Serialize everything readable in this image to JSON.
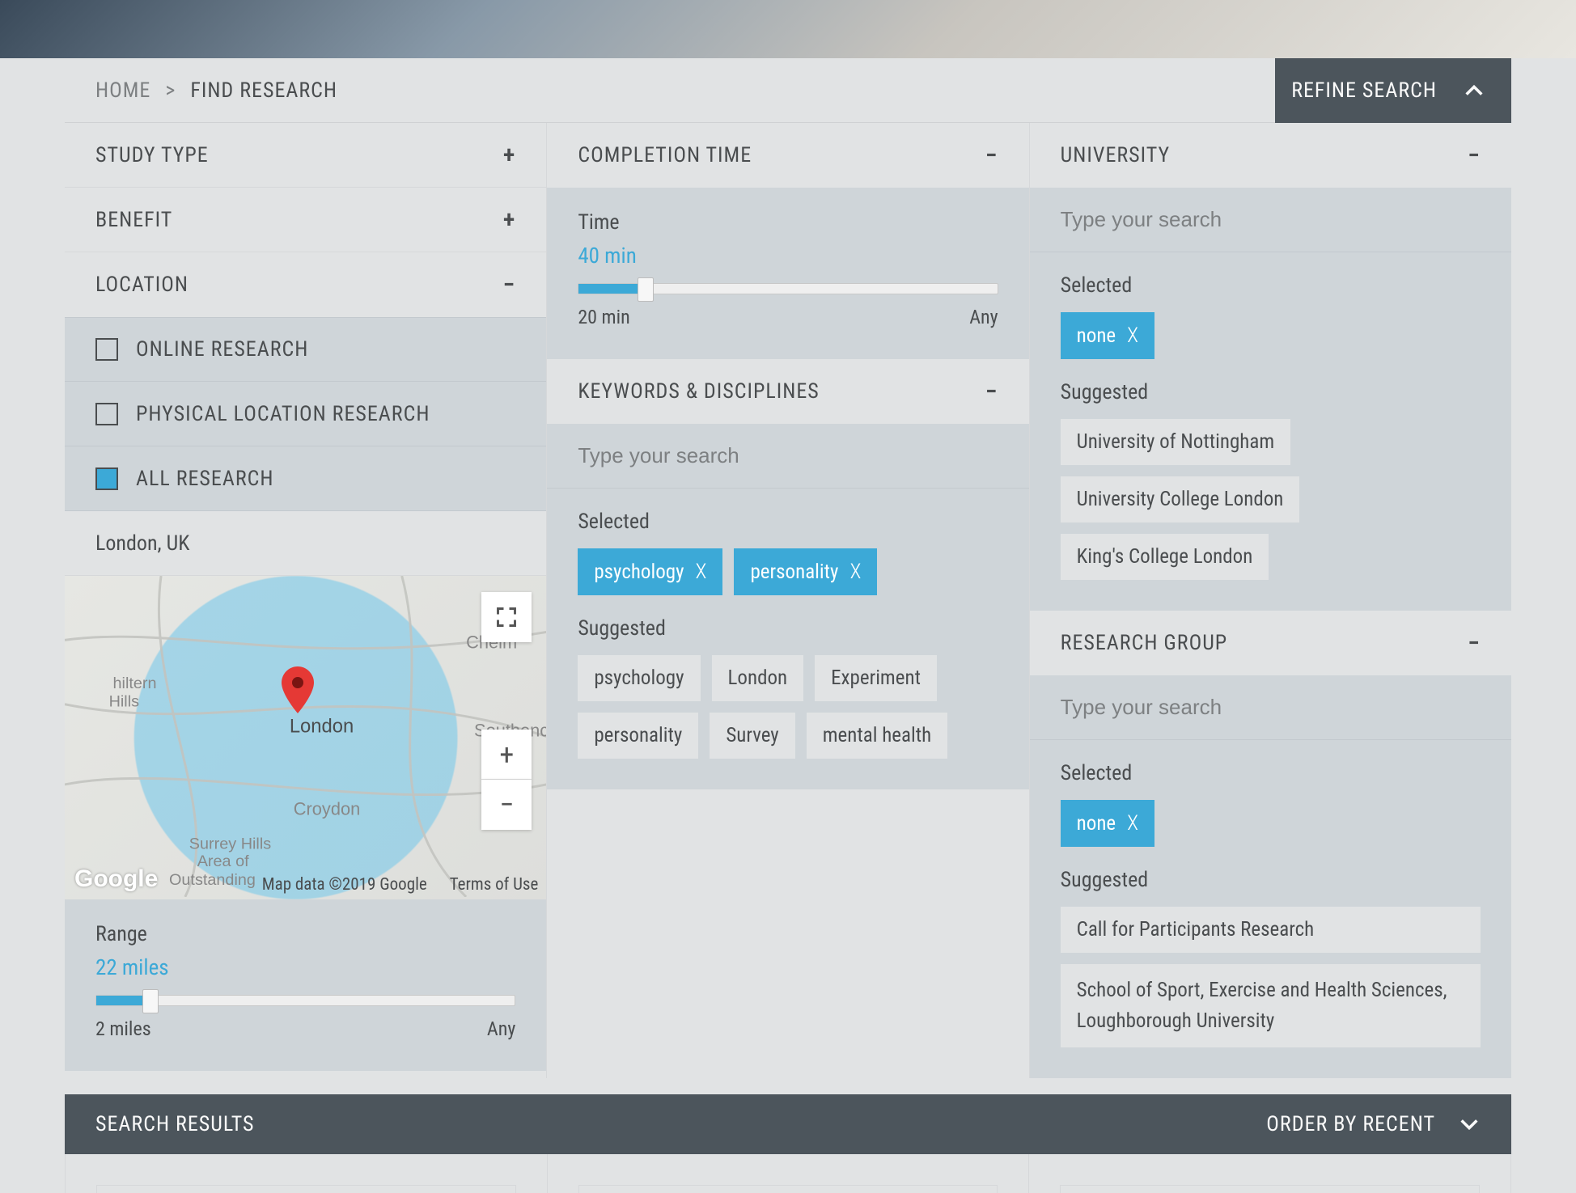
{
  "breadcrumb": {
    "home": "HOME",
    "sep": ">",
    "current": "FIND RESEARCH"
  },
  "refine_search": {
    "label": "REFINE SEARCH"
  },
  "filters": {
    "study_type": {
      "title": "STUDY TYPE"
    },
    "benefit": {
      "title": "BENEFIT"
    },
    "location": {
      "title": "LOCATION",
      "options": {
        "online": "ONLINE RESEARCH",
        "physical": "PHYSICAL LOCATION RESEARCH",
        "all": "ALL RESEARCH"
      },
      "location_name": "London, UK",
      "map": {
        "attribution": "Map data ©2019 Google",
        "terms": "Terms of Use",
        "logo": "Google"
      },
      "range": {
        "label": "Range",
        "value": "22 miles",
        "min": "2 miles",
        "max": "Any",
        "percent": 13
      }
    },
    "completion_time": {
      "title": "COMPLETION TIME",
      "time": {
        "label": "Time",
        "value": "40 min",
        "min": "20 min",
        "max": "Any",
        "percent": 16
      }
    },
    "keywords": {
      "title": "KEYWORDS & DISCIPLINES",
      "placeholder": "Type your search",
      "selected_label": "Selected",
      "selected": [
        "psychology",
        "personality"
      ],
      "suggested_label": "Suggested",
      "suggested": [
        "psychology",
        "London",
        "Experiment",
        "personality",
        "Survey",
        "mental health"
      ]
    },
    "university": {
      "title": "UNIVERSITY",
      "placeholder": "Type your search",
      "selected_label": "Selected",
      "selected": [
        "none"
      ],
      "suggested_label": "Suggested",
      "suggested": [
        "University of Nottingham",
        "University College London",
        "King's College London"
      ]
    },
    "research_group": {
      "title": "RESEARCH GROUP",
      "placeholder": "Type your search",
      "selected_label": "Selected",
      "selected": [
        "none"
      ],
      "suggested_label": "Suggested",
      "suggested": [
        "Call for Participants Research",
        "School of Sport, Exercise and Health Sciences, Loughborough University"
      ]
    }
  },
  "results_bar": {
    "label": "SEARCH RESULTS",
    "order": "ORDER BY RECENT"
  }
}
